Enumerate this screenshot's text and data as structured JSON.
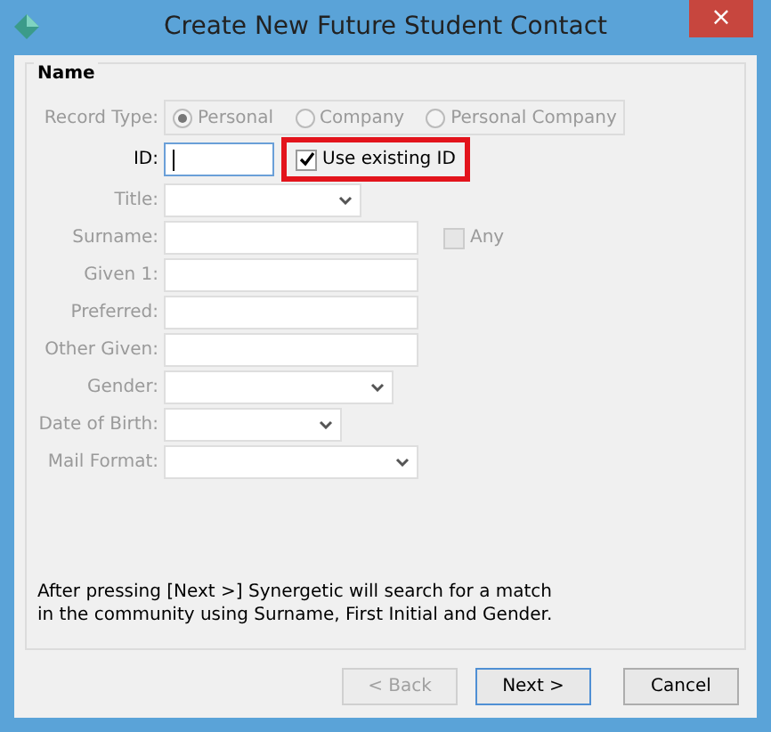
{
  "window": {
    "title": "Create New Future Student Contact",
    "close": "×"
  },
  "group": {
    "label": "Name"
  },
  "record_type": {
    "label": "Record Type:",
    "disabled": true,
    "options": [
      {
        "label": "Personal",
        "selected": true
      },
      {
        "label": "Company",
        "selected": false
      },
      {
        "label": "Personal Company",
        "selected": false
      }
    ]
  },
  "fields": [
    {
      "kind": "text",
      "label": "ID:",
      "disabled": false,
      "focused": true,
      "checkbox": {
        "label": "Use existing ID",
        "checked": true,
        "disabled": false,
        "highlighted": true
      }
    },
    {
      "kind": "select",
      "label": "Title:",
      "disabled": true
    },
    {
      "kind": "text",
      "label": "Surname:",
      "disabled": true,
      "focused": false,
      "checkbox": {
        "label": "Any",
        "checked": false,
        "disabled": true,
        "highlighted": false
      }
    },
    {
      "kind": "text",
      "label": "Given 1:",
      "disabled": true,
      "focused": false
    },
    {
      "kind": "text",
      "label": "Preferred:",
      "disabled": true,
      "focused": false
    },
    {
      "kind": "text",
      "label": "Other Given:",
      "disabled": true,
      "focused": false
    },
    {
      "kind": "select",
      "label": "Gender:",
      "disabled": true
    },
    {
      "kind": "select",
      "label": "Date of Birth:",
      "disabled": true
    },
    {
      "kind": "select",
      "label": "Mail Format:",
      "disabled": true
    }
  ],
  "note": "After pressing [Next >] Synergetic will search for a match in the community using Surname, First Initial and Gender.",
  "buttons": [
    {
      "label": "< Back",
      "disabled": true,
      "default": false
    },
    {
      "label": "Next >",
      "disabled": false,
      "default": true
    },
    {
      "label": "Cancel",
      "disabled": false,
      "default": false
    }
  ]
}
